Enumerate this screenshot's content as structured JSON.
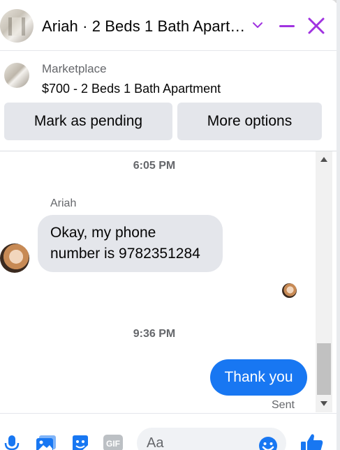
{
  "chat": {
    "title": "Ariah · 2 Beds 1 Bath Apart…"
  },
  "marketplace": {
    "label": "Marketplace",
    "listing": "$700 - 2 Beds 1 Bath Apartment",
    "mark_pending_label": "Mark as pending",
    "more_options_label": "More options"
  },
  "conversation": {
    "time_1": "6:05 PM",
    "sender_name": "Ariah",
    "incoming_line_1": "Okay, my phone",
    "incoming_line_2": "number is 9782351284",
    "time_2": "9:36 PM",
    "outgoing_text": "Thank you",
    "status": "Sent"
  },
  "composer": {
    "placeholder": "Aa"
  },
  "icons": [
    "chevron-down-icon",
    "minimize-icon",
    "close-icon",
    "microphone-icon",
    "photo-icon",
    "sticker-icon",
    "gif-icon",
    "emoji-icon",
    "thumbs-up-icon"
  ],
  "colors": {
    "accent": "#a033e0",
    "bubble_out": "#1877f2",
    "bubble_in": "#e4e6eb",
    "button_bg": "#e4e6eb"
  }
}
